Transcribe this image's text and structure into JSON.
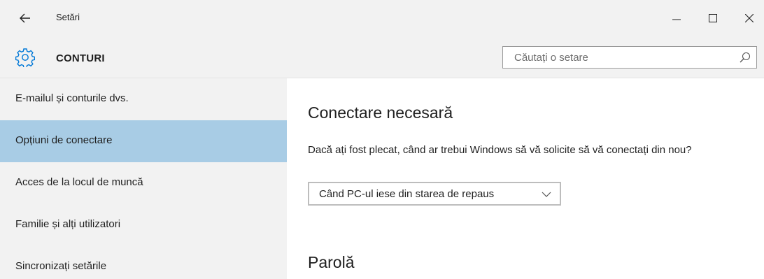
{
  "titlebar": {
    "title": "Setări"
  },
  "header": {
    "title": "CONTURI",
    "search_placeholder": "Căutați o setare"
  },
  "sidebar": {
    "items": [
      {
        "label": "E-mailul și conturile dvs.",
        "selected": false
      },
      {
        "label": "Opțiuni de conectare",
        "selected": true
      },
      {
        "label": "Acces de la locul de muncă",
        "selected": false
      },
      {
        "label": "Familie și alți utilizatori",
        "selected": false
      },
      {
        "label": "Sincronizați setările",
        "selected": false
      }
    ]
  },
  "main": {
    "sign_in": {
      "title": "Conectare necesară",
      "question": "Dacă ați fost plecat, când ar trebui Windows să vă solicite să vă conectați din nou?",
      "dropdown_value": "Când PC-ul iese din starea de repaus"
    },
    "password": {
      "title": "Parolă"
    }
  },
  "colors": {
    "chrome_bg": "#f2f2f2",
    "selected_bg": "#a8cce5",
    "accent": "#0078d7"
  }
}
